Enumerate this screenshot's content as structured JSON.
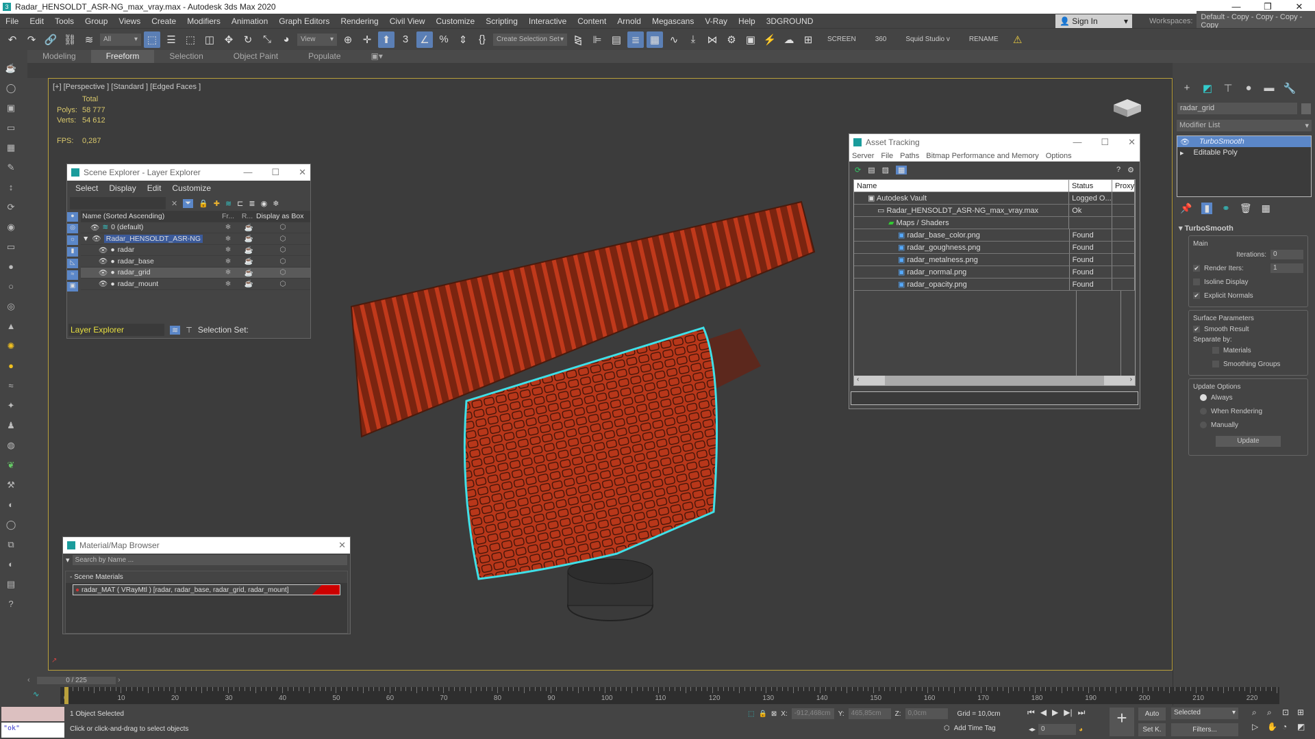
{
  "window": {
    "title": "Radar_HENSOLDT_ASR-NG_max_vray.max - Autodesk 3ds Max 2020",
    "controls": [
      "—",
      "❐",
      "✕"
    ]
  },
  "menu": [
    "File",
    "Edit",
    "Tools",
    "Group",
    "Views",
    "Create",
    "Modifiers",
    "Animation",
    "Graph Editors",
    "Rendering",
    "Civil View",
    "Customize",
    "Scripting",
    "Interactive",
    "Content",
    "Arnold",
    "Megascans",
    "V-Ray",
    "Help",
    "3DGROUND"
  ],
  "account": {
    "sign_in": "Sign In",
    "workspaces_label": "Workspaces:",
    "workspace": "Default - Copy - Copy - Copy - Copy"
  },
  "toolbar": {
    "filter": "All",
    "ref_coord": "View",
    "selection_set": "Create Selection Set",
    "screen": "SCREEN",
    "n360": "360",
    "squid": "Squid Studio v",
    "rename": "RENAME"
  },
  "ribbon": {
    "tabs": [
      "Modeling",
      "Freeform",
      "Selection",
      "Object Paint",
      "Populate"
    ],
    "active": "Freeform"
  },
  "viewport": {
    "label": "[+] [Perspective ] [Standard ] [Edged Faces ]",
    "total": "Total",
    "polys_label": "Polys:",
    "polys": "58 777",
    "verts_label": "Verts:",
    "verts": "54 612",
    "fps_label": "FPS:",
    "fps": "0,287",
    "object_color": "#c0391b",
    "selection_color": "#3fe0e8"
  },
  "scene_explorer": {
    "title": "Scene Explorer - Layer Explorer",
    "menu": [
      "Select",
      "Display",
      "Edit",
      "Customize"
    ],
    "columns": [
      "Name (Sorted Ascending)",
      "Fr...",
      "R...",
      "Display as Box"
    ],
    "rows": [
      {
        "name": "0 (default)"
      },
      {
        "name": "Radar_HENSOLDT_ASR-NG"
      },
      {
        "name": "radar"
      },
      {
        "name": "radar_base"
      },
      {
        "name": "radar_grid"
      },
      {
        "name": "radar_mount"
      }
    ],
    "footer_mode": "Layer Explorer",
    "selection_set": "Selection Set:"
  },
  "asset_tracking": {
    "title": "Asset Tracking",
    "menu": [
      "Server",
      "File",
      "Paths",
      "Bitmap Performance and Memory",
      "Options"
    ],
    "columns": [
      "Name",
      "Status",
      "Proxy"
    ],
    "rows": [
      {
        "name": "Autodesk Vault",
        "status": "Logged O..."
      },
      {
        "name": "Radar_HENSOLDT_ASR-NG_max_vray.max",
        "status": "Ok"
      },
      {
        "name": "Maps / Shaders",
        "status": ""
      },
      {
        "name": "radar_base_color.png",
        "status": "Found"
      },
      {
        "name": "radar_goughness.png",
        "status": "Found"
      },
      {
        "name": "radar_metalness.png",
        "status": "Found"
      },
      {
        "name": "radar_normal.png",
        "status": "Found"
      },
      {
        "name": "radar_opacity.png",
        "status": "Found"
      }
    ]
  },
  "material_browser": {
    "title": "Material/Map Browser",
    "search_placeholder": "Search by Name ...",
    "group": "- Scene Materials",
    "material": "radar_MAT  ( VRayMtl )  [radar, radar_base, radar_grid, radar_mount]"
  },
  "command_panel": {
    "object_name": "radar_grid",
    "modifier_list": "Modifier List",
    "stack": [
      "TurboSmooth",
      "Editable Poly"
    ],
    "rollout": "TurboSmooth",
    "main": "Main",
    "iterations_label": "Iterations:",
    "iterations": "0",
    "render_iters_label": "Render Iters:",
    "render_iters": "1",
    "isoline": "Isoline Display",
    "explicit_normals": "Explicit Normals",
    "surface": "Surface Parameters",
    "smooth_result": "Smooth Result",
    "separate_by": "Separate by:",
    "materials": "Materials",
    "smoothing_groups": "Smoothing Groups",
    "update_options": "Update Options",
    "always": "Always",
    "when_rendering": "When Rendering",
    "manually": "Manually",
    "update": "Update"
  },
  "timeline": {
    "frame": "0 / 225",
    "ticks": [
      "0",
      "10",
      "20",
      "30",
      "40",
      "50",
      "60",
      "70",
      "80",
      "90",
      "100",
      "110",
      "120",
      "130",
      "140",
      "150",
      "160",
      "170",
      "180",
      "190",
      "200",
      "210",
      "220"
    ]
  },
  "status": {
    "maxscript": "\"ok\"",
    "selected": "1 Object Selected",
    "prompt": "Click or click-and-drag to select objects",
    "x_label": "X:",
    "x": "-912,468cm",
    "y_label": "Y:",
    "y": "465,85cm",
    "z_label": "Z:",
    "z": "0,0cm",
    "grid": "Grid = 10,0cm",
    "add_time_tag": "Add Time Tag",
    "frame": "0",
    "auto": "Auto",
    "set_key": "Set K.",
    "key_filter": "Selected",
    "filters": "Filters..."
  }
}
